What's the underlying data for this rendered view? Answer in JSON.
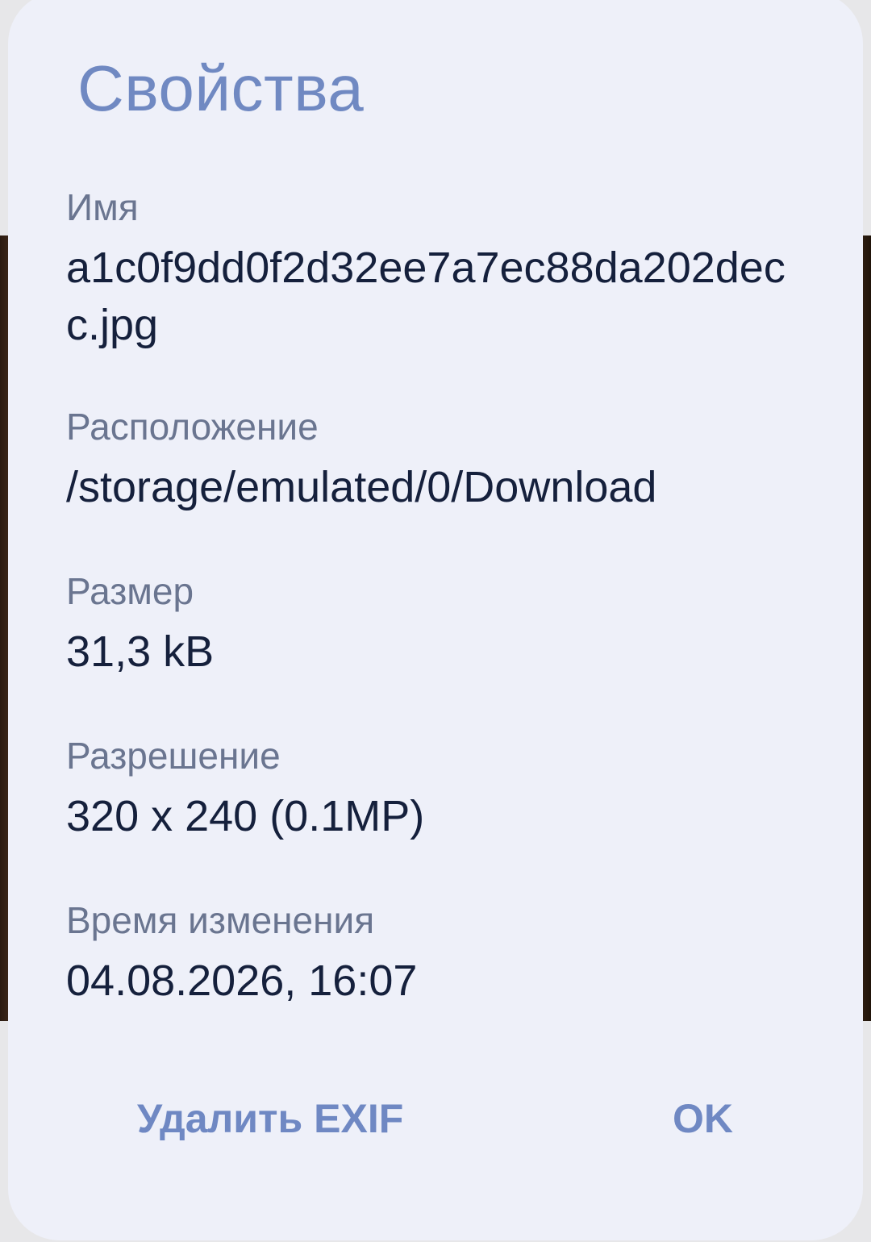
{
  "dialog": {
    "title": "Свойства",
    "properties": [
      {
        "label": "Имя",
        "value": "a1c0f9dd0f2d32ee7a7ec88da202decc.jpg"
      },
      {
        "label": "Расположение",
        "value": "/storage/emulated/0/Download"
      },
      {
        "label": "Размер",
        "value": "31,3 kB"
      },
      {
        "label": "Разрешение",
        "value": "320 x 240 (0.1MP)"
      },
      {
        "label": "Время изменения",
        "value": "04.08.2026, 16:07"
      }
    ],
    "buttons": {
      "remove_exif": "Удалить EXIF",
      "ok": "OK"
    }
  },
  "colors": {
    "title": "#7089c2",
    "label": "#6a7590",
    "value": "#15203c",
    "button": "#6f88c3",
    "dialog_background": "#eef0f9"
  }
}
